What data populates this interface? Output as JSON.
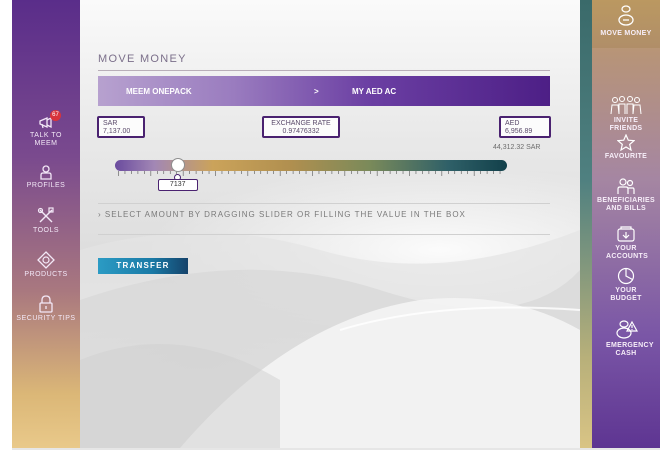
{
  "left_nav": {
    "items": [
      {
        "label": "TALK TO MEEM",
        "icon": "megaphone-icon",
        "badge": "67"
      },
      {
        "label": "PROFILES",
        "icon": "person-icon"
      },
      {
        "label": "TOOLS",
        "icon": "tools-icon"
      },
      {
        "label": "PRODUCTS",
        "icon": "products-icon"
      },
      {
        "label": "SECURITY TIPS",
        "icon": "lock-icon"
      }
    ]
  },
  "main": {
    "title": "MOVE MONEY",
    "route": {
      "from": "MEEM ONEPACK",
      "arrow": ">",
      "to": "MY AED AC"
    },
    "sar": {
      "currency": "SAR",
      "amount": "7,137.00"
    },
    "exchange_rate": {
      "label": "EXCHANGE RATE",
      "value": "0.97476332"
    },
    "aed": {
      "currency": "AED",
      "amount": "6,956.89"
    },
    "max_amount": "44,312.32 SAR",
    "slider": {
      "value": "7137",
      "fraction": 0.16
    },
    "instruction": "SELECT AMOUNT BY DRAGGING SLIDER OR FILLING THE VALUE IN THE BOX",
    "transfer_button": "TRANSFER"
  },
  "right_nav": {
    "items": [
      {
        "label": "MOVE MONEY",
        "icon": "move-money-icon",
        "active": true
      },
      {
        "label": "INVITE FRIENDS",
        "icon": "invite-friends-icon"
      },
      {
        "label": "FAVOURITE",
        "icon": "star-icon"
      },
      {
        "label": "BENEFICIARIES AND BILLS",
        "icon": "beneficiaries-icon"
      },
      {
        "label": "YOUR ACCOUNTS",
        "icon": "accounts-icon"
      },
      {
        "label": "YOUR BUDGET",
        "icon": "budget-pie-icon"
      },
      {
        "label": "EMERGENCY CASH",
        "icon": "emergency-cash-icon"
      }
    ]
  },
  "colors": {
    "brand_purple": "#4d1f86",
    "transfer_blue": "#1a7aa6",
    "badge_red": "#d8343b"
  }
}
